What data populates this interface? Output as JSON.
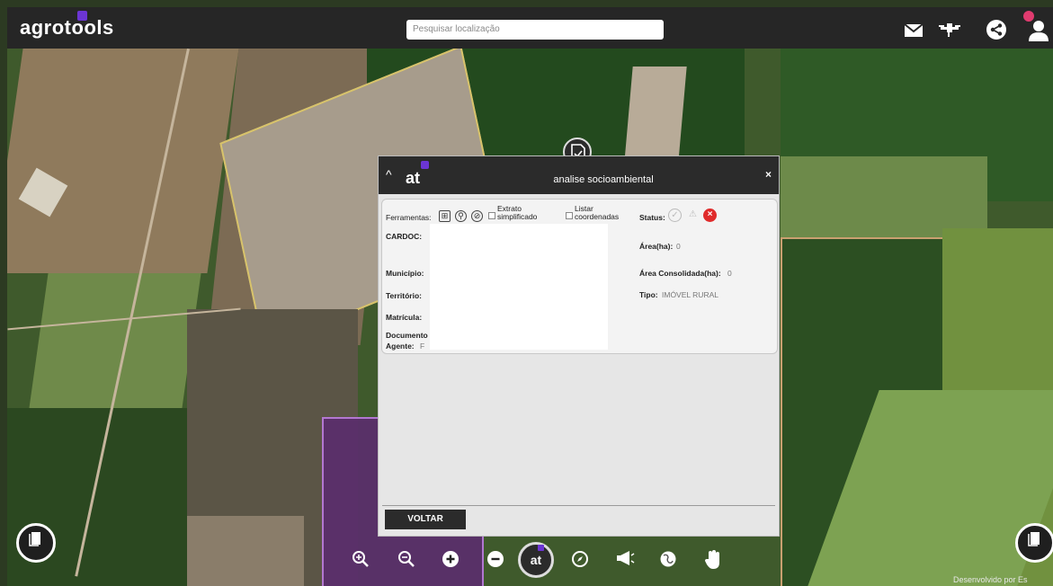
{
  "topbar": {
    "brand": "agrotools",
    "search_placeholder": "Pesquisar localização",
    "notification_count": "",
    "icons": [
      "mail-icon",
      "drone-icon",
      "share-icon",
      "user-icon"
    ]
  },
  "modal": {
    "logo": "at",
    "title": "analise socioambiental",
    "close": "×",
    "collapse": "^",
    "tools_label": "Ferramentas:",
    "extrato_label": "Extrato simplificado",
    "listar_label": "Listar coordenadas",
    "status_label": "Status:",
    "fields": {
      "cardoc_label": "CARDOC:",
      "municipio_label": "Município:",
      "territorio_label": "Território:",
      "matricula_label": "Matrícula:",
      "documento_label": "Documento",
      "agente_label": "Agente:",
      "agente_value": "F",
      "area_label": "Área(ha):",
      "area_value": "0",
      "area_consolidada_label": "Área Consolidada(ha):",
      "area_consolidada_value": "0",
      "tipo_label": "Tipo:",
      "tipo_value": "IMÓVEL RURAL"
    },
    "voltar": "VOLTAR"
  },
  "bottom_toolbar": {
    "center_logo": "at",
    "icons": [
      "zoom-in-icon",
      "zoom-out-icon",
      "plus-icon",
      "minus-icon",
      "compass-icon",
      "megaphone-icon",
      "globe-icon",
      "hand-icon"
    ]
  },
  "credit": "Desenvolvido por Es",
  "colors": {
    "brand_purple": "#6c35d4",
    "dark_bar": "#262626",
    "status_error": "#e02b2b"
  }
}
